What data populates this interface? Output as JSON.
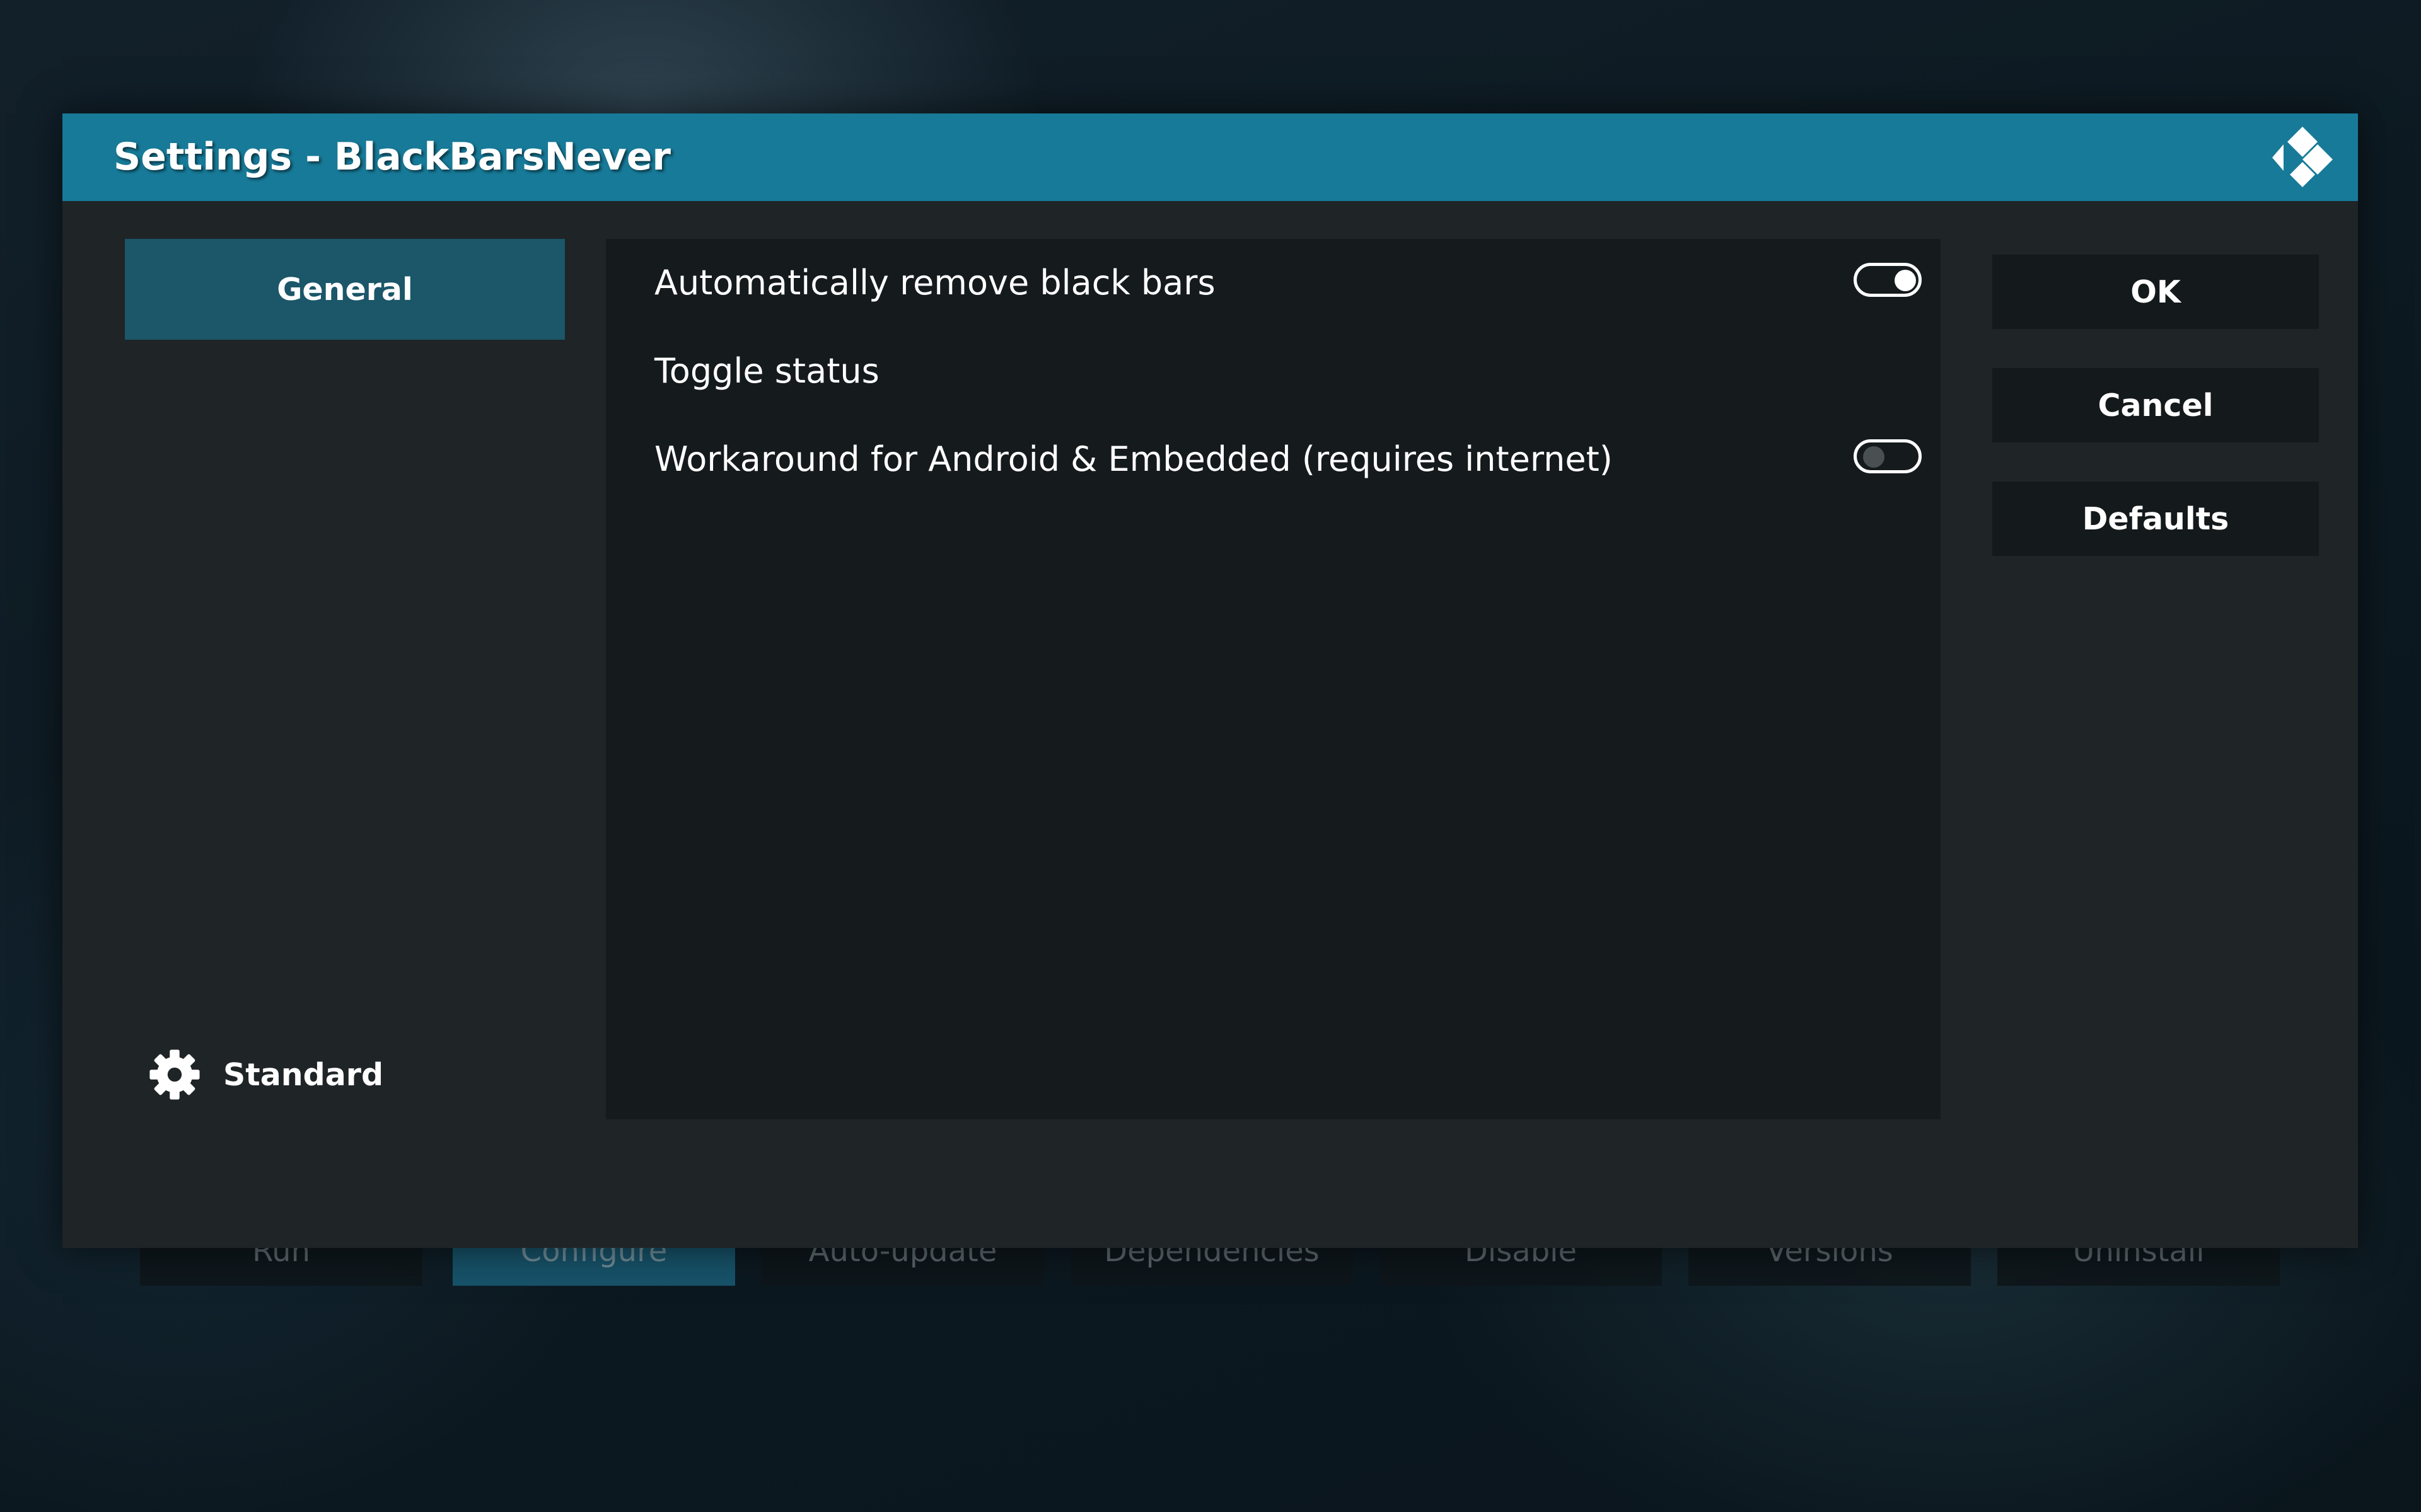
{
  "background": {
    "buttons": [
      {
        "label": "Run",
        "active": false
      },
      {
        "label": "Configure",
        "active": true
      },
      {
        "label": "Auto-update",
        "active": false
      },
      {
        "label": "Dependencies",
        "active": false
      },
      {
        "label": "Disable",
        "active": false
      },
      {
        "label": "Versions",
        "active": false
      },
      {
        "label": "Uninstall",
        "active": false
      }
    ]
  },
  "dialog": {
    "title": "Settings - BlackBarsNever",
    "logo_icon": "kodi-logo-icon",
    "categories": [
      {
        "label": "General",
        "selected": true
      }
    ],
    "settings_level": {
      "icon": "gear-icon",
      "label": "Standard"
    },
    "settings": [
      {
        "label": "Automatically remove black bars",
        "type": "toggle",
        "enabled": true
      },
      {
        "label": "Toggle status",
        "type": "action"
      },
      {
        "label": "Workaround for Android & Embedded (requires internet)",
        "type": "toggle",
        "enabled": false
      }
    ],
    "buttons": {
      "ok": "OK",
      "cancel": "Cancel",
      "defaults": "Defaults"
    }
  },
  "colors": {
    "header": "#177a98",
    "selected_category": "#1b5669",
    "dialog_bg": "#1f2427",
    "panel_bg": "#151a1c"
  }
}
